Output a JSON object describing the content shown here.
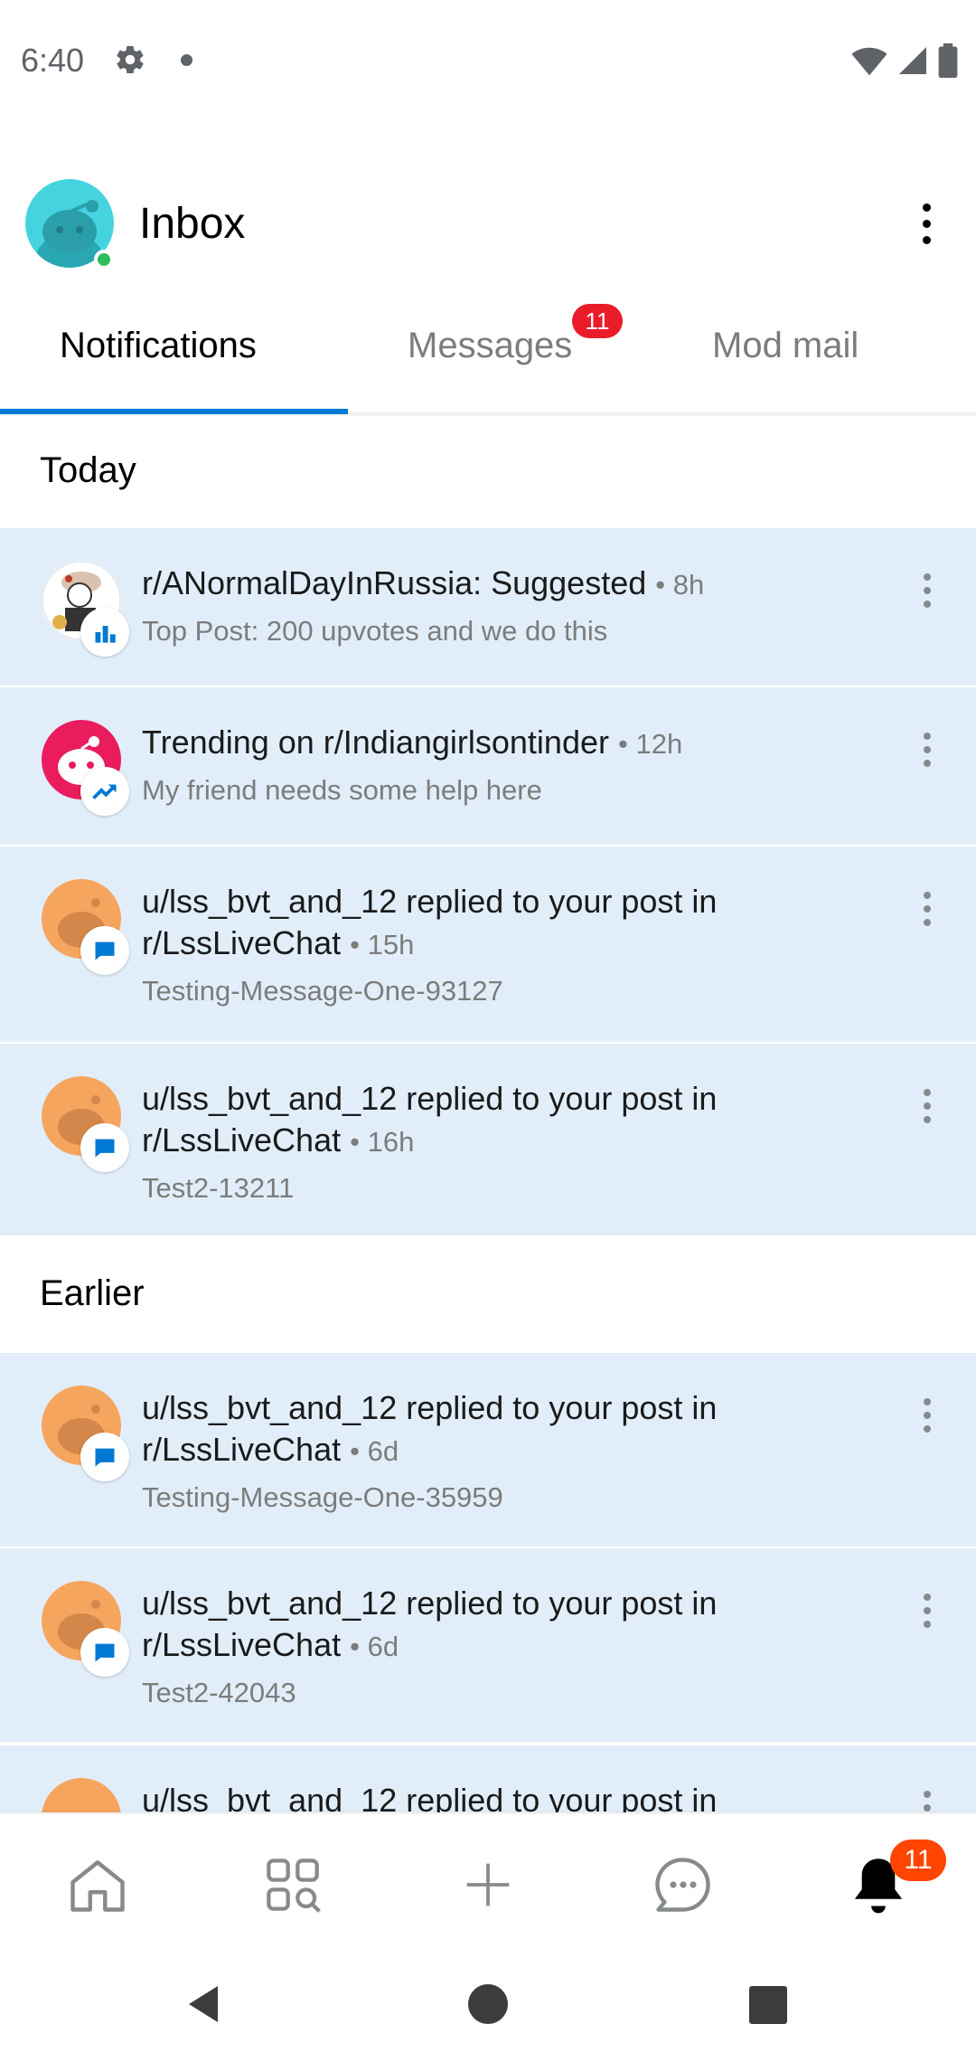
{
  "status_bar": {
    "time": "6:40"
  },
  "header": {
    "title": "Inbox"
  },
  "tabs": [
    {
      "label": "Notifications",
      "active": true
    },
    {
      "label": "Messages",
      "badge": "11"
    },
    {
      "label": "Mod mail"
    }
  ],
  "sections": {
    "today": "Today",
    "earlier": "Earlier"
  },
  "notifications": [
    {
      "title": "r/ANormalDayInRussia: Suggested",
      "time": "8h",
      "body": "Top Post: 200 upvotes and we do this",
      "icon": "subreddit-avatar",
      "badge_icon": "top-post-icon"
    },
    {
      "title": "Trending on r/Indiangirlsontinder",
      "time": "12h",
      "body": "My friend needs some help here",
      "icon": "subreddit-avatar",
      "badge_icon": "trending-icon"
    },
    {
      "title": "u/lss_bvt_and_12 replied to your post in r/LssLiveChat",
      "time": "15h",
      "body": "Testing-Message-One-93127",
      "icon": "user-avatar",
      "badge_icon": "reply-icon"
    },
    {
      "title": "u/lss_bvt_and_12 replied to your post in r/LssLiveChat",
      "time": "16h",
      "body": "Test2-13211",
      "icon": "user-avatar",
      "badge_icon": "reply-icon"
    },
    {
      "title": "u/lss_bvt_and_12 replied to your post in r/LssLiveChat",
      "time": "6d",
      "body": "Testing-Message-One-35959",
      "icon": "user-avatar",
      "badge_icon": "reply-icon"
    },
    {
      "title": "u/lss_bvt_and_12 replied to your post in r/LssLiveChat",
      "time": "6d",
      "body": "Test2-42043",
      "icon": "user-avatar",
      "badge_icon": "reply-icon"
    },
    {
      "title": "u/lss_bvt_and_12 replied to your post in",
      "time": "",
      "body": "",
      "icon": "user-avatar",
      "badge_icon": "reply-icon"
    }
  ],
  "bottom_nav": {
    "items": [
      "home-icon",
      "communities-icon",
      "create-icon",
      "chat-icon",
      "inbox-bell-icon"
    ],
    "inbox_badge": "11"
  },
  "colors": {
    "accent": "#0079d3",
    "unread_bg": "#e1eefa",
    "badge_red": "#ea1c2a",
    "badge_orange": "#ff4500"
  }
}
